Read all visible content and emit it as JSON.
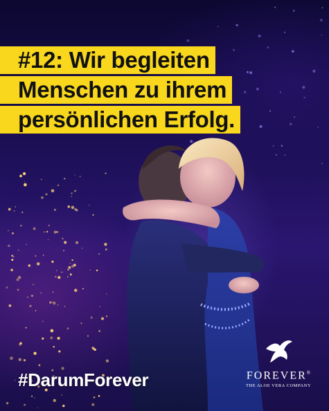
{
  "headline": {
    "lines": [
      "#12: Wir begleiten",
      "Menschen zu ihrem",
      "persönlichen Erfolg."
    ],
    "background_color": "#f9d71c",
    "text_color": "#111111"
  },
  "hashtag": "#DarumForever",
  "logo": {
    "icon": "bird-icon",
    "brand": "FOREVER",
    "registered": "®",
    "tagline": "THE ALOE VERA COMPANY"
  },
  "colors": {
    "background": "#1c0f55",
    "spark": "#ffd27a",
    "accent": "#f9d71c"
  }
}
